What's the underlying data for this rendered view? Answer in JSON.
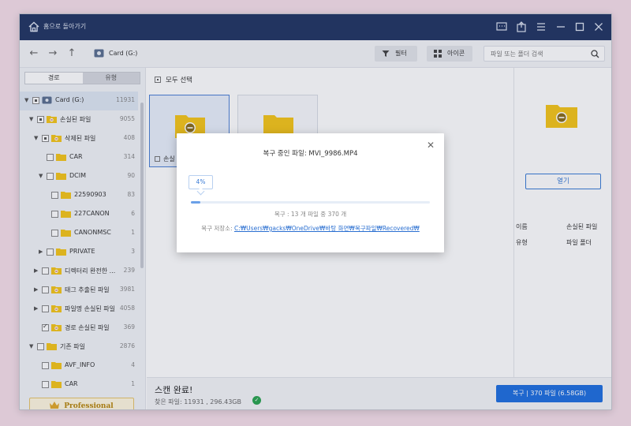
{
  "titlebar": {
    "title": "홈으로 돌아가기"
  },
  "toolbar": {
    "location": "Card  (G:)",
    "filter_label": "필터",
    "view_label": "아이콘",
    "search_placeholder": "파일 또는 폴더 검색"
  },
  "sidebar": {
    "tabs": [
      "경로",
      "유형"
    ],
    "tree": [
      {
        "label": "Card  (G:)",
        "count": "11931"
      },
      {
        "label": "손실된 파일",
        "count": "9055"
      },
      {
        "label": "삭제된 파일",
        "count": "408"
      },
      {
        "label": "CAR",
        "count": "314"
      },
      {
        "label": "DCIM",
        "count": "90"
      },
      {
        "label": "22590903",
        "count": "83"
      },
      {
        "label": "227CANON",
        "count": "6"
      },
      {
        "label": "CANONMSC",
        "count": "1"
      },
      {
        "label": "PRIVATE",
        "count": "3"
      },
      {
        "label": "디렉터리 완전한 ...",
        "count": "239"
      },
      {
        "label": "태그 추출된 파일",
        "count": "3981"
      },
      {
        "label": "파일명 손실된 파일",
        "count": "4058"
      },
      {
        "label": "경로 손실된 파일",
        "count": "369"
      },
      {
        "label": "기존 파일",
        "count": "2876"
      },
      {
        "label": "AVF_INFO",
        "count": "4"
      },
      {
        "label": "CAR",
        "count": "1"
      }
    ],
    "pro_label": "Professional"
  },
  "main": {
    "select_all": "모두 선택",
    "card_caption": "손실"
  },
  "rpanel": {
    "open_label": "열기",
    "name_key": "이름",
    "name_val": "손실된 파일",
    "type_key": "유형",
    "type_val": "파일 폴더"
  },
  "bottom": {
    "status": "스캔 완료!",
    "found": "찾은 파일: 11931 , 296.43GB",
    "recover_label": "복구 | 370 파일 (6.58GB)"
  },
  "dialog": {
    "title": "복구 중인 파일: MVI_9986.MP4",
    "percent_label": "4%",
    "progress": 0.04,
    "stat": "복구 : 13 개 파일 중 370 개",
    "path_label": "복구 저장소:",
    "path_link": "C:₩Users₩gacks₩OneDrive₩바탕 화면₩복구파일₩Recovered₩"
  },
  "colors": {
    "titlebar": "#223562",
    "accent": "#1e6fe0",
    "folder": "#f5c518"
  }
}
